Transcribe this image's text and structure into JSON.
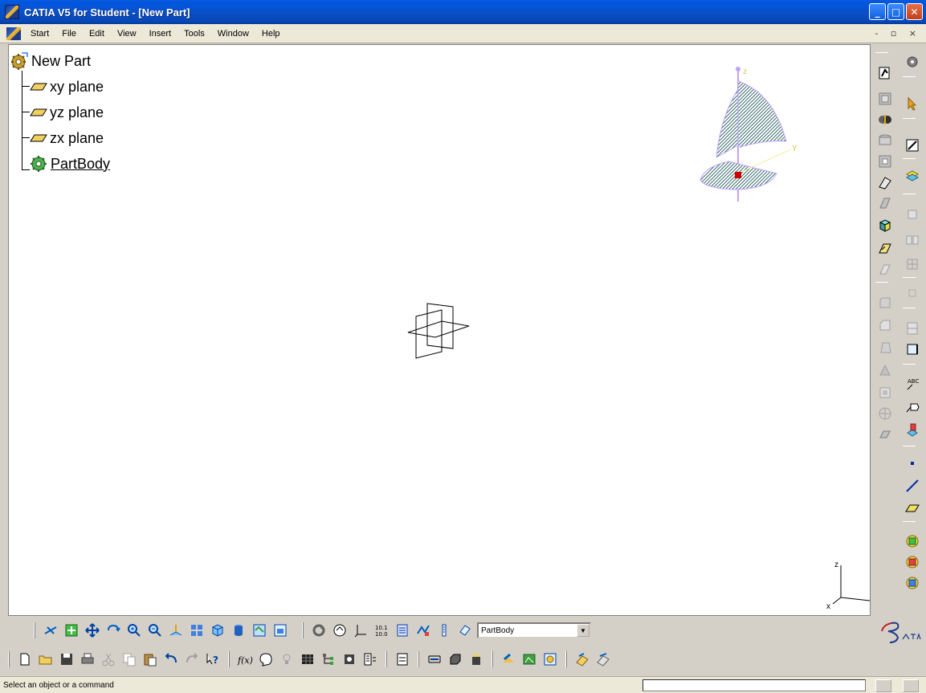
{
  "window": {
    "title": "CATIA V5 for Student - [New Part]",
    "buttons": {
      "minimize": "_",
      "maximize": "□",
      "close": "✕"
    }
  },
  "menubar": {
    "items": [
      {
        "label": "Start"
      },
      {
        "label": "File"
      },
      {
        "label": "Edit"
      },
      {
        "label": "View"
      },
      {
        "label": "Insert"
      },
      {
        "label": "Tools"
      },
      {
        "label": "Window"
      },
      {
        "label": "Help"
      }
    ],
    "mdi_controls": "- ▫ ×"
  },
  "tree": {
    "root": "New Part",
    "children": [
      {
        "label": "xy plane",
        "icon": "plane-icon"
      },
      {
        "label": "yz plane",
        "icon": "plane-icon"
      },
      {
        "label": "zx plane",
        "icon": "plane-icon"
      },
      {
        "label": "PartBody",
        "icon": "partbody-gear-icon"
      }
    ]
  },
  "compass": {
    "z_label": "z",
    "y_label": "Y"
  },
  "axis_triad": {
    "z_label": "z",
    "x_label": "x"
  },
  "toolbar": {
    "current_body": "PartBody"
  },
  "status": {
    "message": "Select an object or a command",
    "command_value": ""
  },
  "colors": {
    "title_bar": "#0a50c8",
    "viewport_bg": "#ffffff",
    "compass_fill": "#5a8a8a",
    "compass_marker": "#cc0000",
    "compass_axis": "#c0a0ff"
  }
}
